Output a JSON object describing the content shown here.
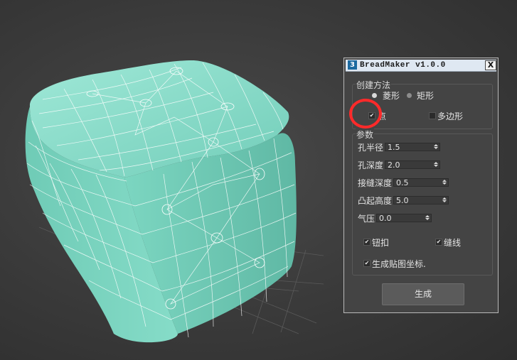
{
  "dialog": {
    "title": "BreadMaker v1.0.0",
    "app_icon": "3",
    "close_label": "X",
    "create_group": {
      "title": "创建方法",
      "shape_options": [
        {
          "label": "菱形",
          "selected": true
        },
        {
          "label": "矩形",
          "selected": false
        }
      ],
      "point_label": "点",
      "point_checked": true,
      "polygon_label": "多边形",
      "polygon_checked": false
    },
    "params_group": {
      "title": "参数",
      "fields": [
        {
          "label": "孔半径",
          "value": "1.5"
        },
        {
          "label": "孔深度",
          "value": "2.0"
        },
        {
          "label": "接缝深度",
          "value": "0.5"
        },
        {
          "label": "凸起高度",
          "value": "5.0"
        },
        {
          "label": "气压",
          "value": "0.0"
        }
      ],
      "twist_label": "钮扣",
      "twist_checked": true,
      "seam_label": "缝线",
      "seam_checked": true,
      "uv_label": "生成贴图坐标.",
      "uv_checked": true
    },
    "generate_label": "生成"
  },
  "highlight": {
    "color": "#ff2a2a"
  },
  "model": {
    "color": "#7fd9c4",
    "wire_color": "#ffffff"
  }
}
